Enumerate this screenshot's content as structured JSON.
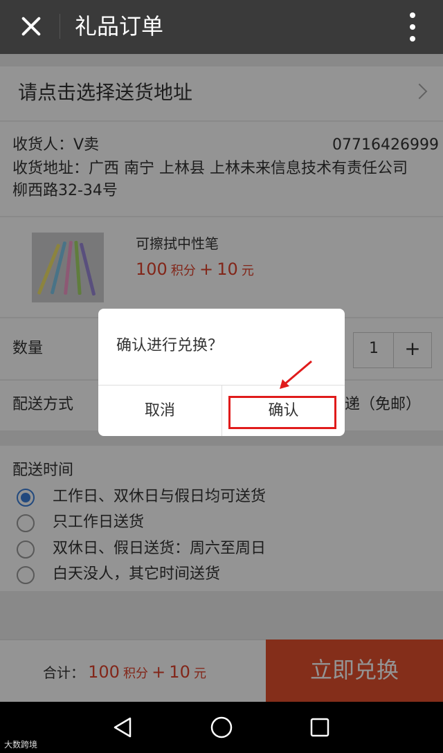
{
  "topbar": {
    "title": "礼品订单"
  },
  "address": {
    "select_prompt": "请点击选择送货地址"
  },
  "recipient": {
    "name_label": "收货人：V卖",
    "phone": "07716426999",
    "address_line1": "收货地址：广西 南宁 上林县 上林未来信息技术有责任公司",
    "address_line2": "柳西路32-34号"
  },
  "product": {
    "name": "可擦拭中性笔",
    "points": "100",
    "points_unit": "积分",
    "plus": "+",
    "cash": "10",
    "cash_unit": "元"
  },
  "quantity": {
    "label": "数量",
    "value": "1",
    "plus": "+"
  },
  "shipping": {
    "label": "配送方式",
    "value_visible": "递（免邮）"
  },
  "delivery_time": {
    "label": "配送时间",
    "options": [
      {
        "label": "工作日、双休日与假日均可送货",
        "selected": true
      },
      {
        "label": "只工作日送货",
        "selected": false
      },
      {
        "label": "双休日、假日送货：周六至周日",
        "selected": false
      },
      {
        "label": "白天没人，其它时间送货",
        "selected": false
      }
    ]
  },
  "footer": {
    "total_label": "合计：",
    "points": "100",
    "points_unit": "积分",
    "plus": "+",
    "cash": "10",
    "cash_unit": "元",
    "buy_label": "立即兑换"
  },
  "dialog": {
    "message": "确认进行兑换？",
    "cancel_label": "取消",
    "ok_label": "确认"
  },
  "watermark": "大数跨境",
  "colors": {
    "accent": "#e4502d",
    "price": "#e0422c",
    "radio": "#3b7fd9",
    "highlight": "#e01b1b"
  }
}
